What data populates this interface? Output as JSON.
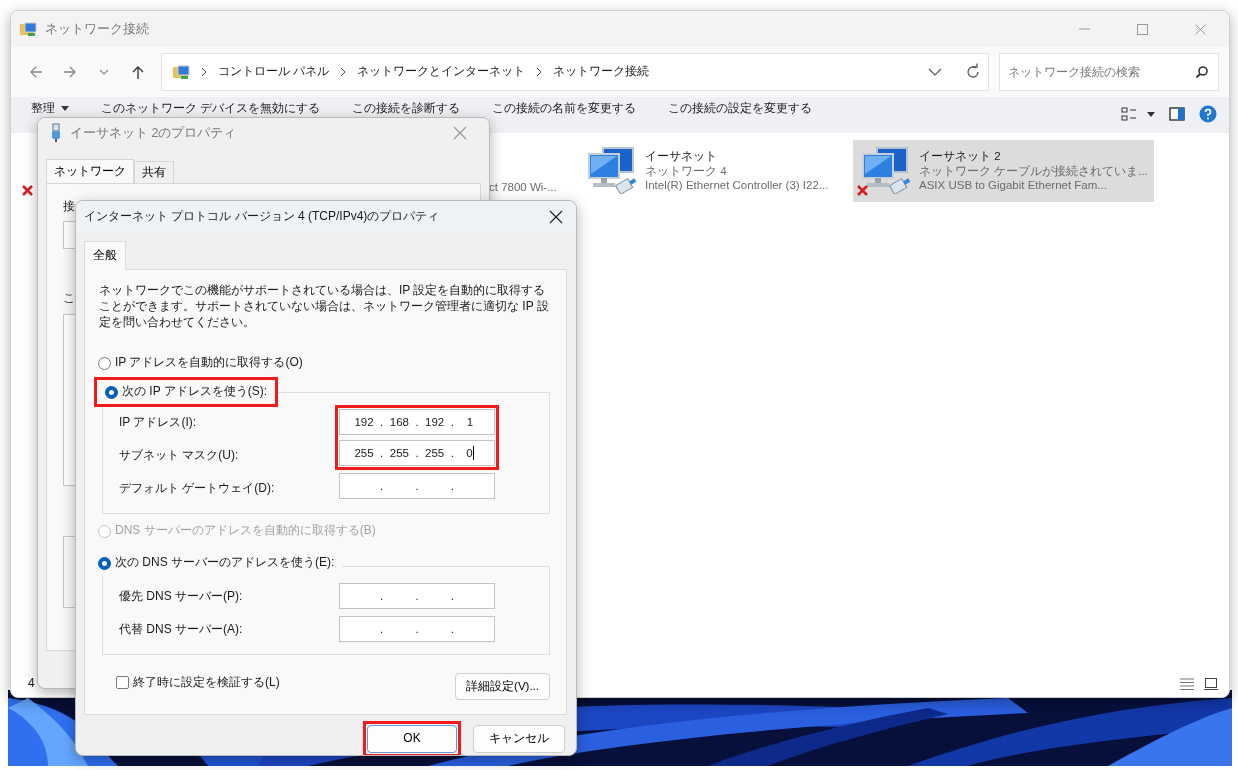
{
  "explorer": {
    "title": "ネットワーク接続",
    "breadcrumb": [
      "コントロール パネル",
      "ネットワークとインターネット",
      "ネットワーク接続"
    ],
    "search": {
      "placeholder": "ネットワーク接続の検索"
    },
    "commands": [
      {
        "label": "整理",
        "kind": "menu"
      },
      {
        "label": "このネットワーク デバイスを無効にする",
        "kind": "action"
      },
      {
        "label": "この接続を診断する",
        "kind": "action"
      },
      {
        "label": "この接続の名前を変更する",
        "kind": "action"
      },
      {
        "label": "この接続の設定を変更する",
        "kind": "action"
      }
    ],
    "adapters": [
      {
        "kind": "fragment",
        "disconnected": true,
        "selected": false
      },
      {
        "kind": "fragment",
        "device": "ct 7800 Wi-...",
        "disconnected": false,
        "selected": false
      },
      {
        "kind": "full",
        "name": "イーサネット",
        "network": "ネットワーク 4",
        "device": "Intel(R) Ethernet Controller (3) I22...",
        "disconnected": false,
        "selected": false
      },
      {
        "kind": "full",
        "name": "イーサネット 2",
        "network": "ネットワーク ケーブルが接続されていま...",
        "device": "ASIX USB to Gigabit Ethernet Fam...",
        "disconnected": true,
        "selected": true
      }
    ],
    "status_bar": {
      "item_count": "4"
    }
  },
  "adapter_properties": {
    "title": "イーサネット 2のプロパティ",
    "tabs": [
      {
        "label": "ネットワーク",
        "selected": true
      },
      {
        "label": "共有",
        "selected": false
      }
    ],
    "label_fragments": [
      "接",
      "こ"
    ]
  },
  "ipv4_properties": {
    "title": "インターネット プロトコル バージョン 4 (TCP/IPv4)のプロパティ",
    "tabs": [
      {
        "label": "全般",
        "selected": true
      }
    ],
    "description": "ネットワークでこの機能がサポートされている場合は、IP 設定を自動的に取得することができます。サポートされていない場合は、ネットワーク管理者に適切な IP 設定を問い合わせてください。",
    "ip_mode": [
      {
        "label": "IP アドレスを自動的に取得する(O)",
        "selected": false,
        "disabled": false,
        "highlighted": false
      },
      {
        "label": "次の IP アドレスを使う(S):",
        "selected": true,
        "disabled": false,
        "highlighted": true
      }
    ],
    "ip_fields": [
      {
        "label": "IP アドレス(I):",
        "value": "192 . 168 . 192 . 1",
        "focused": false,
        "highlighted": true
      },
      {
        "label": "サブネット マスク(U):",
        "value": "255 . 255 . 255 . 0",
        "focused": true,
        "highlighted": true
      },
      {
        "label": "デフォルト ゲートウェイ(D):",
        "value": ". . .",
        "focused": false,
        "highlighted": false
      }
    ],
    "dns_mode": [
      {
        "label": "DNS サーバーのアドレスを自動的に取得する(B)",
        "selected": false,
        "disabled": true,
        "highlighted": false
      },
      {
        "label": "次の DNS サーバーのアドレスを使う(E):",
        "selected": true,
        "disabled": false,
        "highlighted": false
      }
    ],
    "dns_fields": [
      {
        "label": "優先 DNS サーバー(P):",
        "value": ". . .",
        "focused": false,
        "highlighted": false
      },
      {
        "label": "代替 DNS サーバー(A):",
        "value": ". . .",
        "focused": false,
        "highlighted": false
      }
    ],
    "validate": {
      "label": "終了時に設定を検証する(L)",
      "checked": false
    },
    "advanced_button": "詳細設定(V)...",
    "buttons": [
      {
        "label": "OK",
        "highlighted": true
      },
      {
        "label": "キャンセル",
        "highlighted": false
      }
    ]
  }
}
